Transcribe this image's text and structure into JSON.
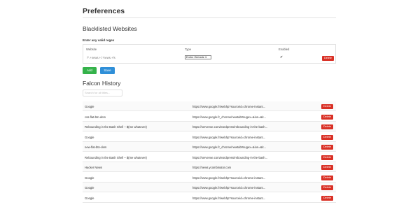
{
  "page": {
    "title": "Preferences"
  },
  "blacklist": {
    "title": "Blacklisted Websites",
    "subtitle": "Enter any valid regex",
    "headers": {
      "website": "Website",
      "type": "Type",
      "enabled": "Enabled"
    },
    "row": {
      "website": "/^.+news.+/.*news.+/s",
      "type": "Entire Website",
      "enabled_mark": "✔",
      "delete_label": "Delete"
    },
    "add_label": "Add",
    "save_label": "Save"
  },
  "history": {
    "title": "Falcon History",
    "search_placeholder": "Search for all titles...",
    "delete_label": "Delete",
    "rows": [
      {
        "title": "Google",
        "url": "https://www.google.fr/webhp?sourceid=chrome-instant..."
      },
      {
        "title": "css-flat-btn-dem",
        "url": "https://www.google.fr_chrome/newtab#sugex=&ion=&it..."
      },
      {
        "title": "Rebounding in the Bash Shell – $(me whatever)",
        "url": "https://serverwe.com/wordpress/rebounding-in-the-bash..."
      },
      {
        "title": "Google",
        "url": "https://www.google.fr/webhp?sourceid=chrome-instant..."
      },
      {
        "title": "new-flat-btn-dem",
        "url": "https://www.google.fr_chrome/newtab#sugex=&ion=&it..."
      },
      {
        "title": "Rebounding in the Bash Shell – $(me whatever)",
        "url": "https://serverwe.com/wordpress/rebounding-in-the-bash..."
      },
      {
        "title": "Hacker News",
        "url": "https://news.ycombinator.com"
      },
      {
        "title": "Google",
        "url": "https://www.google.fr/webhp?sourceid=chrome-instant..."
      },
      {
        "title": "Google",
        "url": "https://www.google.fr/webhp?sourceid=chrome-instant..."
      },
      {
        "title": "Google",
        "url": "https://www.google.fr/webhp?sourceid=chrome-instant..."
      }
    ]
  }
}
